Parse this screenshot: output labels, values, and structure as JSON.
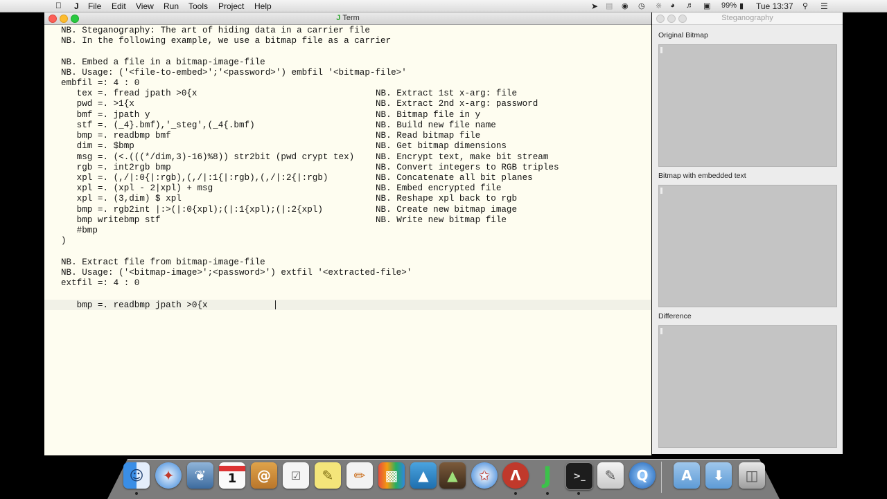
{
  "menubar": {
    "app": "J",
    "items": [
      "File",
      "Edit",
      "View",
      "Run",
      "Tools",
      "Project",
      "Help"
    ],
    "battery": "99%",
    "clock": "Tue 13:37"
  },
  "term": {
    "title": "Term",
    "lines": [
      "NB. Steganography: The art of hiding data in a carrier file",
      "NB. In the following example, we use a bitmap file as a carrier",
      "",
      "NB. Embed a file in a bitmap-image-file",
      "NB. Usage: ('<file-to-embed>';'<password>') embfil '<bitmap-file>'",
      "embfil =: 4 : 0",
      "   tex =. fread jpath >0{x",
      "   pwd =. >1{x",
      "   bmf =. jpath y",
      "   stf =. (_4}.bmf),'_steg',(_4{.bmf)",
      "   bmp =. readbmp bmf",
      "   dim =. $bmp",
      "   msg =. (<.(((*/dim,3)-16)%8)) str2bit (pwd crypt tex)",
      "   rgb =. int2rgb bmp",
      "   xpl =. (,/|:0{|:rgb),(,/|:1{|:rgb),(,/|:2{|:rgb)",
      "   xpl =. (xpl - 2|xpl) + msg",
      "   xpl =. (3,dim) $ xpl",
      "   bmp =. rgb2int |:>(|:0{xpl);(|:1{xpl);(|:2{xpl)",
      "   bmp writebmp stf",
      "   #bmp",
      ")",
      "",
      "NB. Extract file from bitmap-image-file",
      "NB. Usage: ('<bitmap-image>';<password>') extfil '<extracted-file>'",
      "extfil =: 4 : 0",
      "   bmp =. readbmp jpath >0{x"
    ],
    "comments": [
      "NB. Extract 1st x-arg: file",
      "NB. Extract 2nd x-arg: password",
      "NB. Bitmap file in y",
      "NB. Build new file name",
      "NB. Read bitmap file",
      "NB. Get bitmap dimensions",
      "NB. Encrypt text, make bit stream",
      "NB. Convert integers to RGB triples",
      "NB. Concatenate all bit planes",
      "NB. Embed encrypted file",
      "NB. Reshape xpl back to rgb",
      "NB. Create new bitmap image",
      "NB. Write new bitmap file"
    ]
  },
  "steg": {
    "title": "Steganography",
    "panels": [
      "Original Bitmap",
      "Bitmap with embedded text",
      "Difference"
    ]
  },
  "dock": {
    "icons": [
      "finder-icon",
      "safari-icon",
      "preview-icon",
      "calendar-icon",
      "address-book-icon",
      "reminders-icon",
      "stickies-icon",
      "textedit-icon",
      "keynote-icon",
      "numbers-icon",
      "pages-icon",
      "instruments-icon",
      "shell-icon",
      "archive-icon",
      "j-app-icon",
      "terminal-icon",
      "script-editor-icon",
      "quicktime-icon",
      "applications-folder-icon",
      "downloads-folder-icon",
      "trash-icon"
    ],
    "calendar_day": "1"
  }
}
